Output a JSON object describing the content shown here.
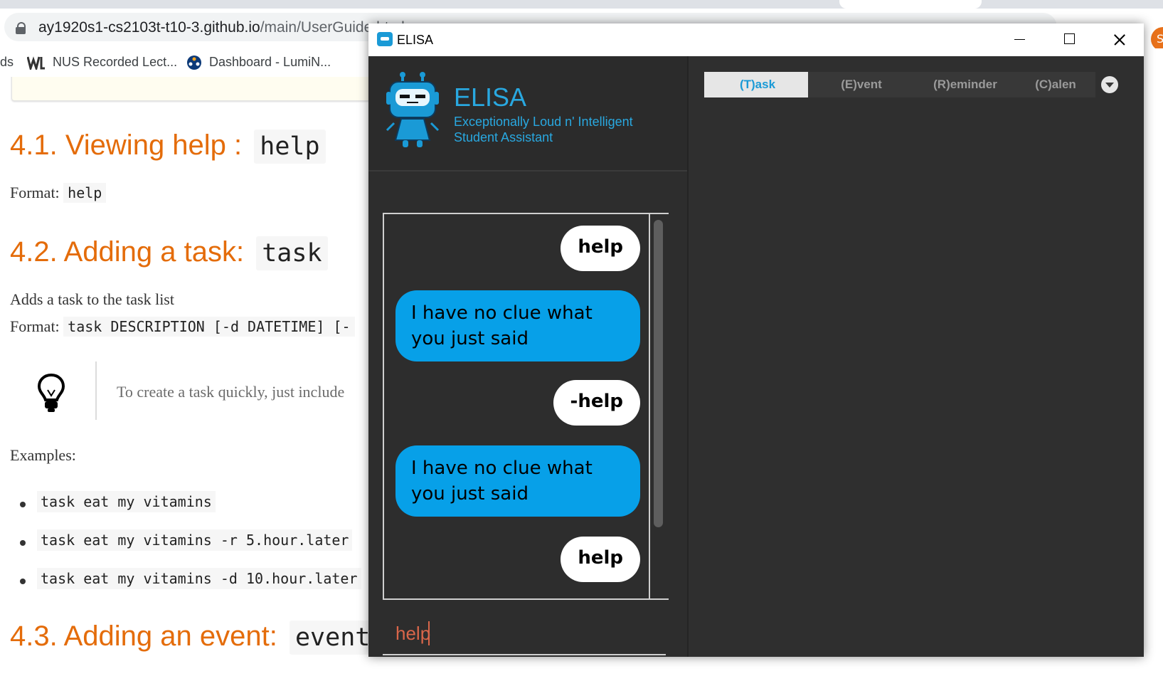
{
  "browser": {
    "url_host": "ay1920s1-cs2103t-t10-3.github.io",
    "url_path": "/main/UserGuide.html",
    "bookmarks": [
      {
        "label": "ds"
      },
      {
        "label": "NUS Recorded Lect..."
      },
      {
        "label": "Dashboard - LumiN..."
      }
    ],
    "profile_initial": "S"
  },
  "guide": {
    "h41": {
      "text": "4.1. Viewing help : ",
      "code": "help"
    },
    "format1": {
      "label": "Format: ",
      "code": "help"
    },
    "h42": {
      "text": "4.2. Adding a task: ",
      "code": "task"
    },
    "desc": "Adds a task to the task list",
    "format2": {
      "label": "Format: ",
      "code": "task DESCRIPTION [-d DATETIME] [-"
    },
    "tip": "To create a task quickly, just include",
    "examples_label": "Examples:",
    "examples": [
      "task eat my vitamins",
      "task eat my vitamins -r 5.hour.later",
      "task eat my vitamins -d 10.hour.later"
    ],
    "h43": {
      "text": "4.3. Adding an event: ",
      "code": "event"
    }
  },
  "elisa": {
    "window_title": "ELISA",
    "name": "ELISA",
    "subtitle": "Exceptionally Loud n' Intelligent Student Assistant",
    "messages": [
      {
        "from": "user",
        "text": "help"
      },
      {
        "from": "bot",
        "text": "I have no clue what you just said"
      },
      {
        "from": "user",
        "text": "-help"
      },
      {
        "from": "bot",
        "text": "I have no clue what you just said"
      },
      {
        "from": "user",
        "text": "help"
      }
    ],
    "input_value": "help",
    "tabs": [
      {
        "label": "(T)ask",
        "active": true
      },
      {
        "label": "(E)vent",
        "active": false
      },
      {
        "label": "(R)eminder",
        "active": false
      },
      {
        "label": "(C)alen",
        "active": false
      }
    ],
    "accent": "#29a8e0",
    "bot_bubble_color": "#07a0e8",
    "input_color": "#d9664a"
  }
}
